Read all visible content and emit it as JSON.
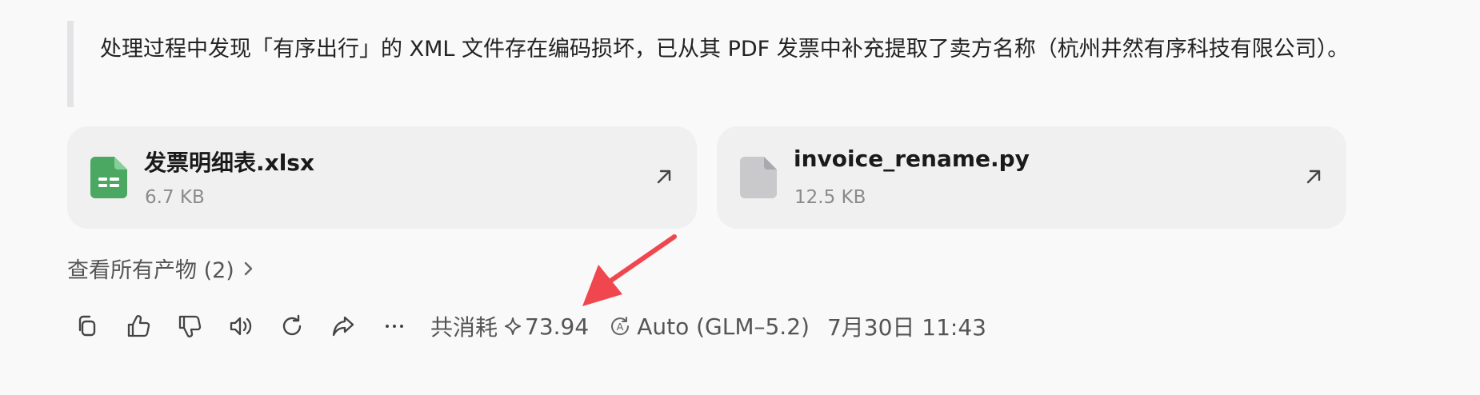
{
  "message": {
    "note": "处理过程中发现「有序出行」的 XML 文件存在编码损坏，已从其 PDF 发票中补充提取了卖方名称（杭州井然有序科技有限公司）。"
  },
  "files": [
    {
      "name": "发票明细表.xlsx",
      "size": "6.7 KB",
      "icon": "spreadsheet-file-icon",
      "color": "#4aa862"
    },
    {
      "name": "invoice_rename.py",
      "size": "12.5 KB",
      "icon": "generic-file-icon",
      "color": "#c9c9cc"
    }
  ],
  "artifacts": {
    "view_all_label": "查看所有产物 (2)"
  },
  "toolbar": {
    "actions": [
      "copy-icon",
      "thumbs-up-icon",
      "thumbs-down-icon",
      "read-aloud-icon",
      "regenerate-icon",
      "share-icon",
      "more-icon"
    ],
    "cost_label": "共消耗",
    "cost_value": "73.94",
    "model_label": "Auto (GLM–5.2)",
    "timestamp": "7月30日 11:43"
  },
  "annotation_color": "#f0474e"
}
